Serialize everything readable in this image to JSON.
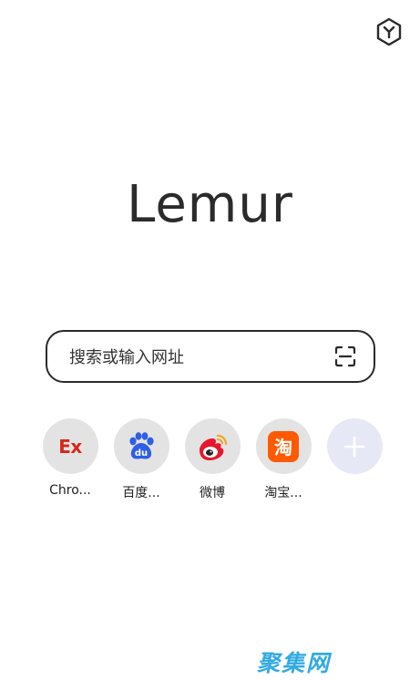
{
  "app": {
    "logo_text": "Lemur"
  },
  "header": {
    "extension_icon": "cube-y-icon"
  },
  "search": {
    "placeholder": "搜索或输入网址",
    "scan_icon": "scan-icon"
  },
  "shortcuts": [
    {
      "label": "Chro...",
      "icon": "ex-extension-icon"
    },
    {
      "label": "百度...",
      "icon": "baidu-paw-icon"
    },
    {
      "label": "微博",
      "icon": "weibo-icon"
    },
    {
      "label": "淘宝...",
      "icon": "taobao-icon",
      "badge_text": "淘"
    },
    {
      "label": "",
      "icon": "add-icon"
    }
  ],
  "ex_badge_text": "Ex",
  "watermark": {
    "text": "聚集网"
  },
  "colors": {
    "accent_red": "#d8261a",
    "baidu_blue": "#2e5ee6",
    "taobao_orange": "#ff5a00",
    "watermark_blue": "#27a6e0"
  }
}
